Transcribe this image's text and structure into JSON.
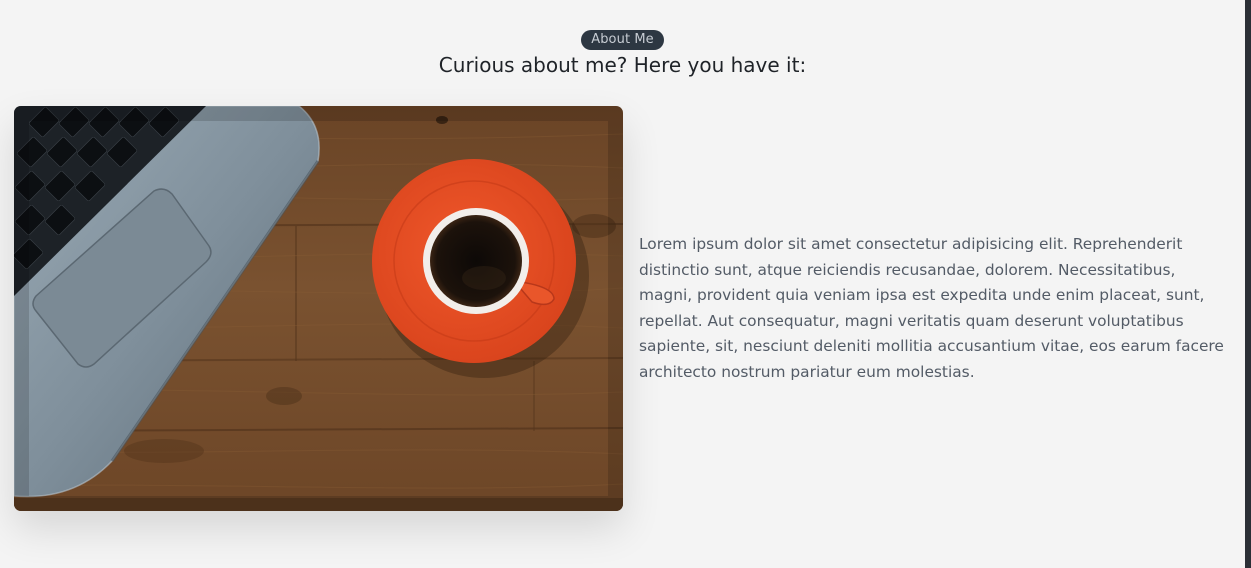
{
  "about": {
    "badge": "About Me",
    "heading": "Curious about me? Here you have it:",
    "paragraph": "Lorem ipsum dolor sit amet consectetur adipisicing elit. Reprehenderit distinctio sunt, atque reiciendis recusandae, dolorem. Necessitatibus, magni, provident quia veniam ipsa est expedita unde enim placeat, sunt, repellat. Aut consequatur, magni veritatis quam deserunt voluptatibus sapiente, sit, nesciunt deleniti mollitia accusantium vitae, eos earum facere architecto nostrum pariatur eum molestias."
  },
  "colors": {
    "background": "#f4f4f4",
    "badge_bg": "#2d3742",
    "badge_text": "#c7ccd3",
    "heading": "#1f2328",
    "body_text": "#535b66",
    "saucer": "#e8532a",
    "wood": "#6b4526"
  },
  "image": {
    "subject": "laptop-and-coffee-cup-on-wooden-desk"
  }
}
